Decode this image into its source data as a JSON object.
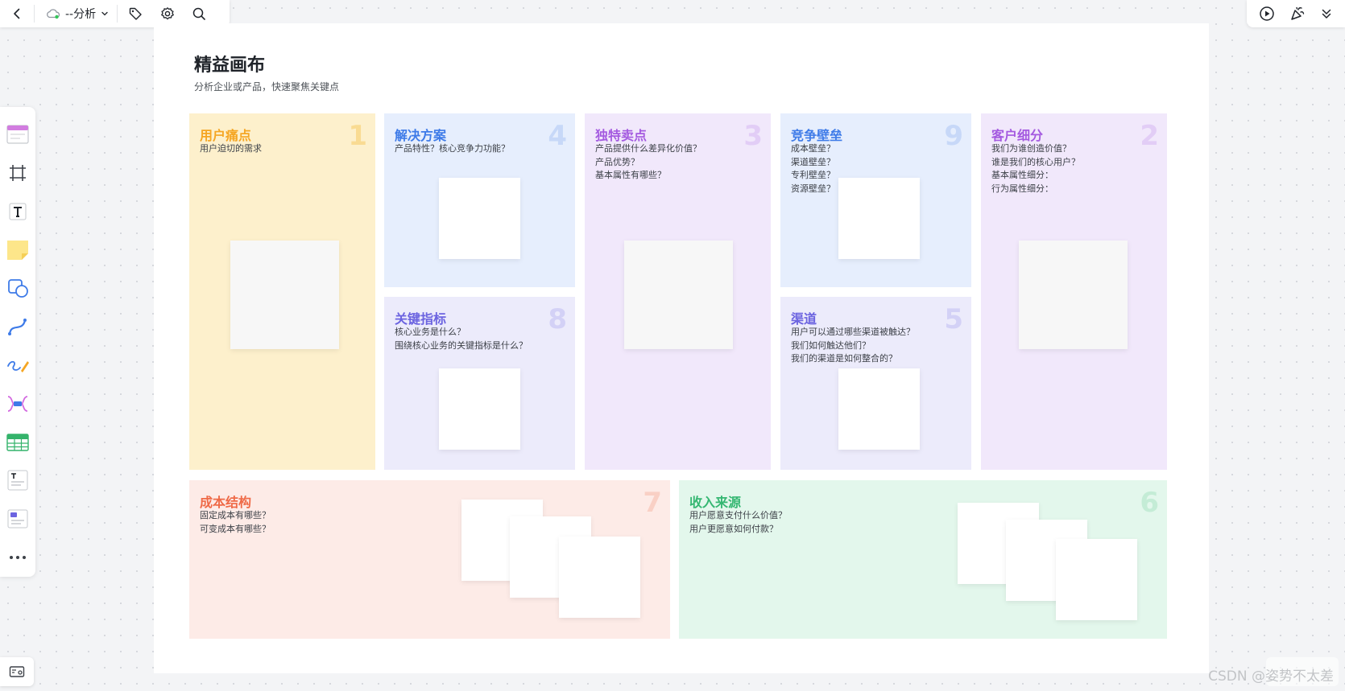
{
  "toolbar": {
    "doc_name": "--分析"
  },
  "page": {
    "title": "精益画布",
    "subtitle": "分析企业或产品，快速聚焦关键点"
  },
  "colors": {
    "pain_bg": "#fdf0cc",
    "pain_title": "#f5a623",
    "solution_bg": "#e6eefd",
    "solution_title": "#3e7be8",
    "usp_bg": "#f1e8fb",
    "usp_title": "#a45ae0",
    "barrier_bg": "#e6eefd",
    "barrier_title": "#3e7be8",
    "segment_bg": "#f1e8fb",
    "segment_title": "#a45ae0",
    "metrics_bg": "#ecebfb",
    "metrics_title": "#6b63e0",
    "channel_bg": "#ecebfb",
    "channel_title": "#6b63e0",
    "cost_bg": "#fdebe7",
    "cost_title": "#ef6a47",
    "revenue_bg": "#e3f7ec",
    "revenue_title": "#35b772"
  },
  "panels": {
    "pain": {
      "title": "用户痛点",
      "num": "1",
      "desc": "用户迫切的需求"
    },
    "solution": {
      "title": "解决方案",
      "num": "4",
      "desc": "产品特性？核心竞争力功能？"
    },
    "usp": {
      "title": "独特卖点",
      "num": "3",
      "desc": "产品提供什么差异化价值？\n产品优势？\n基本属性有哪些？"
    },
    "barrier": {
      "title": "竞争壁垒",
      "num": "9",
      "desc": "成本壁垒？\n渠道壁垒？\n专利壁垒？\n资源壁垒？"
    },
    "segment": {
      "title": "客户细分",
      "num": "2",
      "desc": "我们为谁创造价值？\n谁是我们的核心用户？\n基本属性细分：\n行为属性细分："
    },
    "metrics": {
      "title": "关键指标",
      "num": "8",
      "desc": "核心业务是什么？\n围绕核心业务的关键指标是什么？"
    },
    "channel": {
      "title": "渠道",
      "num": "5",
      "desc": "用户可以通过哪些渠道被触达？\n我们如何触达他们？\n我们的渠道是如何整合的？"
    },
    "cost": {
      "title": "成本结构",
      "num": "7",
      "desc": "固定成本有哪些？\n可变成本有哪些？"
    },
    "revenue": {
      "title": "收入来源",
      "num": "6",
      "desc": "用户愿意支付什么价值？\n用户更愿意如何付款？"
    }
  },
  "watermark": "CSDN @姿势不太差"
}
